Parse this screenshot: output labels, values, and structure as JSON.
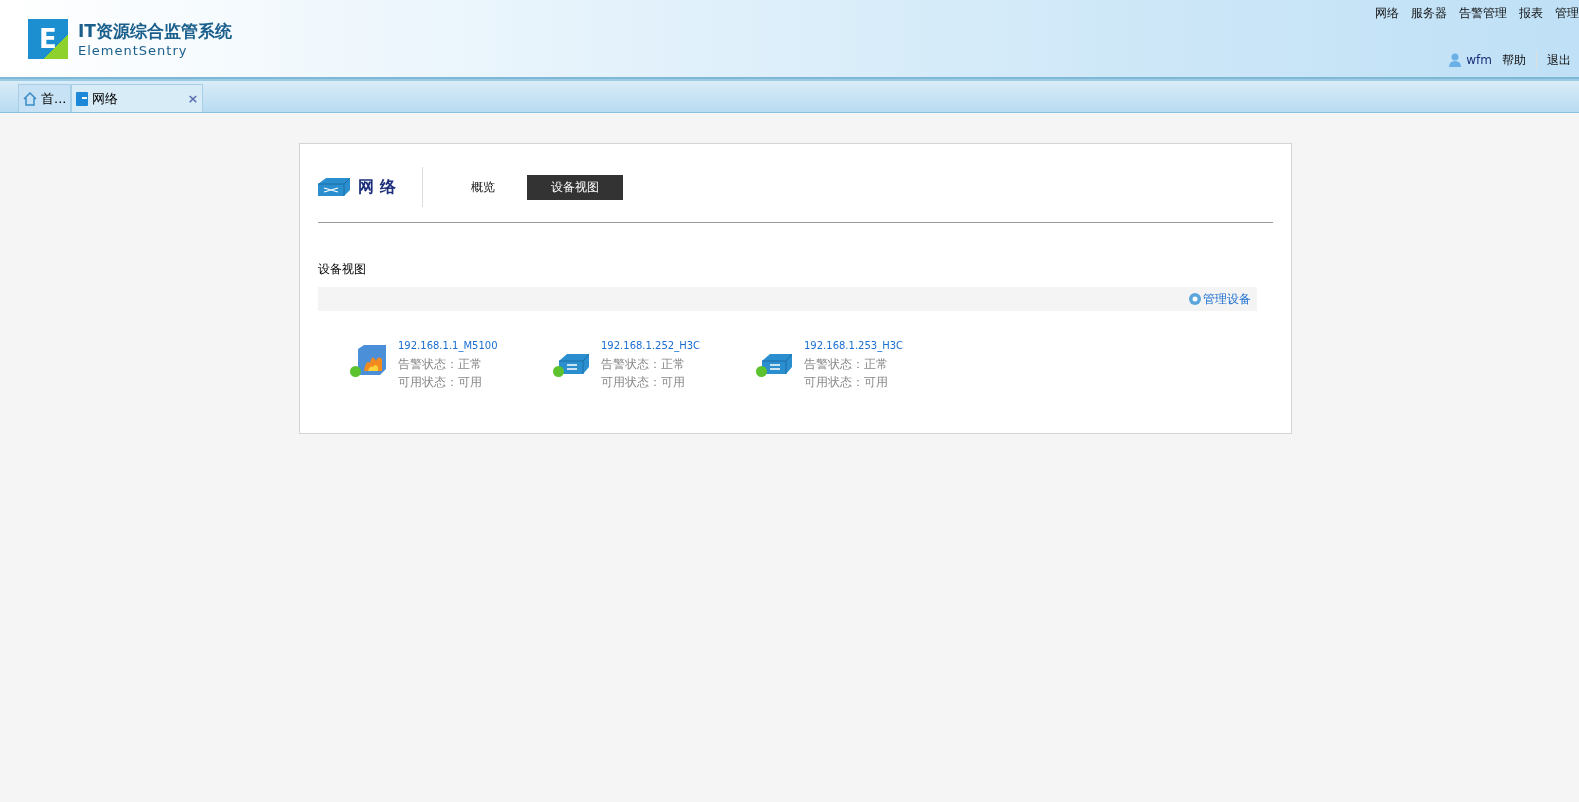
{
  "header": {
    "title": "IT资源综合监管系统",
    "subtitle": "ElementSentry",
    "logo_letter": "E",
    "nav": [
      "网络",
      "服务器",
      "告警管理",
      "报表",
      "管理"
    ],
    "user": "wfm",
    "help": "帮助",
    "logout": "退出"
  },
  "page_tabs": [
    {
      "label": "首...",
      "kind": "home",
      "selected": false
    },
    {
      "label": "网络",
      "kind": "network",
      "selected": true,
      "close": "×"
    }
  ],
  "panel": {
    "heading": "网 络",
    "view_tabs": [
      {
        "label": "概览",
        "selected": false
      },
      {
        "label": "设备视图",
        "selected": true
      }
    ],
    "section_title": "设备视图",
    "manage_link": "管理设备",
    "devices": [
      {
        "name": "192.168.1.1_M5100",
        "kind": "firewall",
        "color": "#5cc22e",
        "alarm": "告警状态：正常",
        "availability": "可用状态：可用"
      },
      {
        "name": "192.168.1.252_H3C",
        "kind": "switch",
        "color": "#5cc22e",
        "alarm": "告警状态：正常",
        "availability": "可用状态：可用"
      },
      {
        "name": "192.168.1.253_H3C",
        "kind": "switch",
        "color": "#5cc22e",
        "alarm": "告警状态：正常",
        "availability": "可用状态：可用"
      }
    ]
  }
}
